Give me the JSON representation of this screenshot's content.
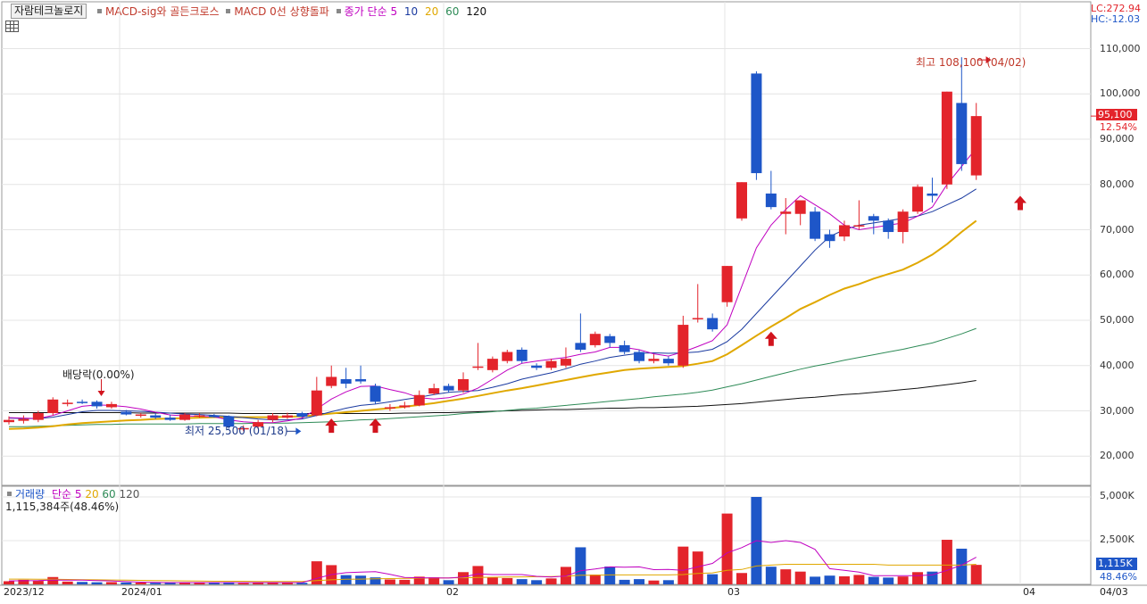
{
  "legend_top": {
    "button": "자람테크놀로지",
    "items": [
      {
        "label": "MACD-sig와 골든크로스",
        "color": "#c0392b"
      },
      {
        "label": "MACD 0선 상향돌파",
        "color": "#c0392b"
      },
      {
        "label": "종가 단순 5",
        "color": "#c000c0"
      }
    ],
    "ma_periods": [
      {
        "label": "10",
        "color": "#1a3aa0"
      },
      {
        "label": "20",
        "color": "#e0a800"
      },
      {
        "label": "60",
        "color": "#2e8b57"
      },
      {
        "label": "120",
        "color": "#111111"
      }
    ]
  },
  "corner": {
    "lc": "LC:272.94",
    "hc": "HC:-12.03"
  },
  "price_axis": [
    "110,000",
    "100,000",
    "90,000",
    "80,000",
    "70,000",
    "60,000",
    "50,000",
    "40,000",
    "30,000",
    "20,000"
  ],
  "current": {
    "price": "95,100",
    "pct": "12.54%"
  },
  "annotations": {
    "high": "최고 108,100 (04/02)",
    "low": "최저 25,500 (01/18)",
    "dividend": "배당락(0.00%)"
  },
  "volume_legend": {
    "label": "거래량",
    "ma": [
      {
        "label": "단순 5",
        "color": "#c000c0"
      },
      {
        "label": "20",
        "color": "#e0a800"
      },
      {
        "label": "60",
        "color": "#2e8b57"
      },
      {
        "label": "120",
        "color": "#555555"
      }
    ],
    "value": "1,115,384주(48.46%)"
  },
  "volume_axis": [
    "5,000K",
    "2,500K"
  ],
  "volume_current": {
    "value": "1,115K",
    "pct": "48.46%"
  },
  "x_labels": [
    "2023/12",
    "2024/01",
    "02",
    "03",
    "04",
    "04/03"
  ],
  "colors": {
    "up": "#e3242b",
    "down": "#1e56c8",
    "grid": "#e4e4e4"
  },
  "chart_data": {
    "type": "candlestick",
    "ylim": [
      15000,
      120000
    ],
    "candles": [
      {
        "o": 27500,
        "h": 28800,
        "l": 27000,
        "c": 28000
      },
      {
        "o": 27800,
        "h": 29000,
        "l": 27200,
        "c": 28200
      },
      {
        "o": 28000,
        "h": 30000,
        "l": 27500,
        "c": 29500
      },
      {
        "o": 29500,
        "h": 33000,
        "l": 29000,
        "c": 32500
      },
      {
        "o": 31500,
        "h": 32500,
        "l": 31000,
        "c": 31800
      },
      {
        "o": 32000,
        "h": 32500,
        "l": 31500,
        "c": 31800
      },
      {
        "o": 32000,
        "h": 32300,
        "l": 30500,
        "c": 31000
      },
      {
        "o": 30800,
        "h": 32000,
        "l": 30500,
        "c": 31500
      },
      {
        "o": 29800,
        "h": 30200,
        "l": 29000,
        "c": 29200
      },
      {
        "o": 29000,
        "h": 29500,
        "l": 28500,
        "c": 29200
      },
      {
        "o": 29000,
        "h": 29500,
        "l": 28200,
        "c": 28500
      },
      {
        "o": 28500,
        "h": 29200,
        "l": 27800,
        "c": 28000
      },
      {
        "o": 28000,
        "h": 29500,
        "l": 27800,
        "c": 29200
      },
      {
        "o": 28800,
        "h": 29500,
        "l": 28500,
        "c": 29000
      },
      {
        "o": 29000,
        "h": 29300,
        "l": 28500,
        "c": 28600
      },
      {
        "o": 28800,
        "h": 29000,
        "l": 26000,
        "c": 26500
      },
      {
        "o": 26000,
        "h": 26800,
        "l": 25500,
        "c": 26200
      },
      {
        "o": 26500,
        "h": 28000,
        "l": 26000,
        "c": 27500
      },
      {
        "o": 28000,
        "h": 29500,
        "l": 27500,
        "c": 29000
      },
      {
        "o": 28500,
        "h": 29600,
        "l": 28200,
        "c": 29000
      },
      {
        "o": 29500,
        "h": 29800,
        "l": 28500,
        "c": 28700
      },
      {
        "o": 29000,
        "h": 37500,
        "l": 28800,
        "c": 34500
      },
      {
        "o": 35500,
        "h": 40000,
        "l": 35000,
        "c": 37500
      },
      {
        "o": 37000,
        "h": 39500,
        "l": 35000,
        "c": 36000
      },
      {
        "o": 37000,
        "h": 40000,
        "l": 36000,
        "c": 36500
      },
      {
        "o": 35500,
        "h": 36000,
        "l": 31500,
        "c": 32000
      },
      {
        "o": 30500,
        "h": 31500,
        "l": 30000,
        "c": 30800
      },
      {
        "o": 30800,
        "h": 32000,
        "l": 30500,
        "c": 31200
      },
      {
        "o": 31200,
        "h": 34500,
        "l": 31000,
        "c": 33500
      },
      {
        "o": 33800,
        "h": 36000,
        "l": 33500,
        "c": 35000
      },
      {
        "o": 35500,
        "h": 36000,
        "l": 34000,
        "c": 34500
      },
      {
        "o": 34500,
        "h": 38500,
        "l": 34000,
        "c": 37000
      },
      {
        "o": 39800,
        "h": 45000,
        "l": 39000,
        "c": 39800
      },
      {
        "o": 39000,
        "h": 42000,
        "l": 38500,
        "c": 41500
      },
      {
        "o": 41000,
        "h": 43500,
        "l": 40500,
        "c": 43000
      },
      {
        "o": 43500,
        "h": 44000,
        "l": 40500,
        "c": 41000
      },
      {
        "o": 40000,
        "h": 40500,
        "l": 39000,
        "c": 39500
      },
      {
        "o": 39500,
        "h": 41500,
        "l": 39000,
        "c": 41000
      },
      {
        "o": 40000,
        "h": 44000,
        "l": 39500,
        "c": 41500
      },
      {
        "o": 45000,
        "h": 51500,
        "l": 43000,
        "c": 43500
      },
      {
        "o": 44500,
        "h": 47500,
        "l": 44000,
        "c": 47000
      },
      {
        "o": 46500,
        "h": 47000,
        "l": 44000,
        "c": 45000
      },
      {
        "o": 44500,
        "h": 45500,
        "l": 42500,
        "c": 43000
      },
      {
        "o": 43000,
        "h": 43500,
        "l": 40500,
        "c": 41000
      },
      {
        "o": 41000,
        "h": 42500,
        "l": 40500,
        "c": 41500
      },
      {
        "o": 41500,
        "h": 42000,
        "l": 40000,
        "c": 40500
      },
      {
        "o": 40000,
        "h": 51000,
        "l": 39500,
        "c": 49000
      },
      {
        "o": 50500,
        "h": 58000,
        "l": 49500,
        "c": 50500
      },
      {
        "o": 50500,
        "h": 51500,
        "l": 47500,
        "c": 48000
      },
      {
        "o": 54000,
        "h": 62000,
        "l": 53000,
        "c": 62000
      },
      {
        "o": 72500,
        "h": 80500,
        "l": 72000,
        "c": 80500
      },
      {
        "o": 104500,
        "h": 105000,
        "l": 81000,
        "c": 82500
      },
      {
        "o": 78000,
        "h": 83000,
        "l": 74500,
        "c": 75000
      },
      {
        "o": 73500,
        "h": 77000,
        "l": 69000,
        "c": 74000
      },
      {
        "o": 73500,
        "h": 76500,
        "l": 71000,
        "c": 76500
      },
      {
        "o": 74000,
        "h": 75000,
        "l": 67500,
        "c": 68000
      },
      {
        "o": 69000,
        "h": 70000,
        "l": 66000,
        "c": 67500
      },
      {
        "o": 68500,
        "h": 72000,
        "l": 67500,
        "c": 71000
      },
      {
        "o": 71000,
        "h": 76500,
        "l": 70000,
        "c": 71000
      },
      {
        "o": 73000,
        "h": 73500,
        "l": 69000,
        "c": 72000
      },
      {
        "o": 72000,
        "h": 72500,
        "l": 68000,
        "c": 69500
      },
      {
        "o": 69500,
        "h": 74500,
        "l": 67000,
        "c": 74000
      },
      {
        "o": 74000,
        "h": 80000,
        "l": 73500,
        "c": 79500
      },
      {
        "o": 78000,
        "h": 81500,
        "l": 76000,
        "c": 77500
      },
      {
        "o": 80000,
        "h": 100500,
        "l": 79000,
        "c": 100500
      },
      {
        "o": 98000,
        "h": 108100,
        "l": 83000,
        "c": 84500
      },
      {
        "o": 82000,
        "h": 98000,
        "l": 81000,
        "c": 95100
      }
    ],
    "ma5": [
      28500,
      28400,
      28300,
      29000,
      30000,
      31000,
      31300,
      31200,
      30900,
      30400,
      29700,
      29100,
      28900,
      28800,
      28700,
      28000,
      27600,
      27400,
      27400,
      27800,
      28400,
      30400,
      32600,
      34200,
      35400,
      35500,
      34700,
      34000,
      32900,
      32600,
      32900,
      33700,
      35000,
      37000,
      39000,
      40500,
      41000,
      41400,
      41800,
      42500,
      43000,
      44000,
      44000,
      43500,
      42600,
      42100,
      43000,
      44200,
      45500,
      49000,
      57500,
      66000,
      71000,
      74500,
      77500,
      75500,
      73500,
      71000,
      70000,
      70500,
      71000,
      71500,
      73000,
      75000,
      80000,
      84000,
      88000
    ],
    "ma10": [
      28400,
      28300,
      28300,
      28600,
      29200,
      29800,
      30100,
      30100,
      30000,
      29900,
      29700,
      29500,
      29300,
      29200,
      29000,
      28800,
      28500,
      28200,
      28000,
      28000,
      28200,
      29000,
      29800,
      30600,
      31200,
      31500,
      32000,
      32500,
      33000,
      33600,
      34100,
      34300,
      34500,
      35200,
      36000,
      37000,
      37700,
      38400,
      39300,
      40300,
      41000,
      41800,
      42300,
      42700,
      42800,
      42700,
      42800,
      43000,
      43600,
      45300,
      48000,
      51500,
      55000,
      58500,
      62000,
      65500,
      68500,
      70000,
      71000,
      71500,
      72000,
      72500,
      73000,
      74000,
      75500,
      77000,
      79000
    ],
    "ma20": [
      26000,
      26100,
      26300,
      26600,
      27000,
      27300,
      27500,
      27700,
      27900,
      28000,
      28200,
      28300,
      28400,
      28500,
      28600,
      28600,
      28600,
      28600,
      28600,
      28700,
      28800,
      29100,
      29400,
      29700,
      30000,
      30300,
      30600,
      30900,
      31300,
      31700,
      32200,
      32700,
      33300,
      33900,
      34500,
      35000,
      35600,
      36200,
      36800,
      37400,
      38000,
      38500,
      39000,
      39300,
      39500,
      39700,
      39900,
      40400,
      41000,
      42500,
      44500,
      46600,
      48600,
      50500,
      52500,
      54000,
      55600,
      57000,
      58000,
      59200,
      60200,
      61200,
      62700,
      64500,
      66800,
      69500,
      72000
    ],
    "ma60": [
      26500,
      26500,
      26600,
      26700,
      26800,
      26900,
      27000,
      27000,
      27100,
      27100,
      27100,
      27100,
      27100,
      27200,
      27200,
      27200,
      27200,
      27300,
      27300,
      27300,
      27400,
      27500,
      27600,
      27800,
      28000,
      28100,
      28300,
      28500,
      28700,
      28900,
      29100,
      29400,
      29600,
      29800,
      30100,
      30400,
      30600,
      30900,
      31200,
      31500,
      31800,
      32100,
      32400,
      32700,
      33100,
      33400,
      33700,
      34100,
      34600,
      35300,
      36000,
      36800,
      37600,
      38400,
      39200,
      39900,
      40500,
      41200,
      41800,
      42400,
      43000,
      43600,
      44300,
      45000,
      46000,
      47000,
      48200
    ],
    "ma120": [
      29600,
      29600,
      29600,
      29600,
      29600,
      29600,
      29600,
      29600,
      29600,
      29500,
      29500,
      29500,
      29500,
      29500,
      29500,
      29500,
      29400,
      29400,
      29400,
      29400,
      29400,
      29400,
      29400,
      29400,
      29400,
      29400,
      29400,
      29500,
      29500,
      29600,
      29600,
      29700,
      29800,
      29900,
      30000,
      30100,
      30200,
      30300,
      30300,
      30400,
      30500,
      30600,
      30600,
      30700,
      30700,
      30800,
      30900,
      31000,
      31200,
      31400,
      31600,
      31900,
      32200,
      32500,
      32800,
      33000,
      33300,
      33600,
      33800,
      34100,
      34400,
      34700,
      35000,
      35400,
      35800,
      36200,
      36700
    ],
    "volume_k": [
      180,
      260,
      200,
      420,
      160,
      140,
      120,
      130,
      110,
      100,
      90,
      100,
      110,
      90,
      80,
      130,
      70,
      80,
      100,
      120,
      90,
      1320,
      1100,
      530,
      500,
      400,
      280,
      260,
      440,
      400,
      240,
      700,
      1050,
      400,
      360,
      300,
      240,
      340,
      1000,
      2120,
      560,
      1020,
      260,
      300,
      220,
      240,
      2160,
      1880,
      580,
      4050,
      650,
      5000,
      1010,
      860,
      730,
      440,
      500,
      460,
      540,
      430,
      390,
      450,
      700,
      730,
      2550,
      2040,
      1115
    ],
    "volume_ma5": [
      200,
      210,
      220,
      250,
      240,
      240,
      220,
      200,
      160,
      130,
      110,
      100,
      100,
      100,
      100,
      100,
      100,
      100,
      100,
      100,
      100,
      340,
      560,
      670,
      700,
      730,
      570,
      400,
      380,
      370,
      360,
      420,
      600,
      560,
      560,
      560,
      460,
      420,
      480,
      780,
      880,
      1000,
      980,
      1000,
      840,
      850,
      800,
      1000,
      1200,
      1800,
      2100,
      2500,
      2400,
      2500,
      2400,
      2000,
      900,
      800,
      700,
      500,
      500,
      500,
      500,
      540,
      800,
      1100,
      1550
    ],
    "volume_ma20": [
      300,
      300,
      290,
      290,
      280,
      270,
      260,
      250,
      240,
      230,
      220,
      210,
      200,
      190,
      180,
      180,
      180,
      170,
      170,
      170,
      170,
      220,
      260,
      290,
      300,
      320,
      330,
      340,
      350,
      360,
      370,
      380,
      400,
      410,
      420,
      430,
      440,
      450,
      470,
      520,
      520,
      540,
      540,
      540,
      540,
      540,
      560,
      620,
      660,
      800,
      850,
      1050,
      1100,
      1150,
      1150,
      1150,
      1150,
      1150,
      1150,
      1150,
      1100,
      1100,
      1100,
      1100,
      1100,
      1100,
      1150
    ]
  }
}
